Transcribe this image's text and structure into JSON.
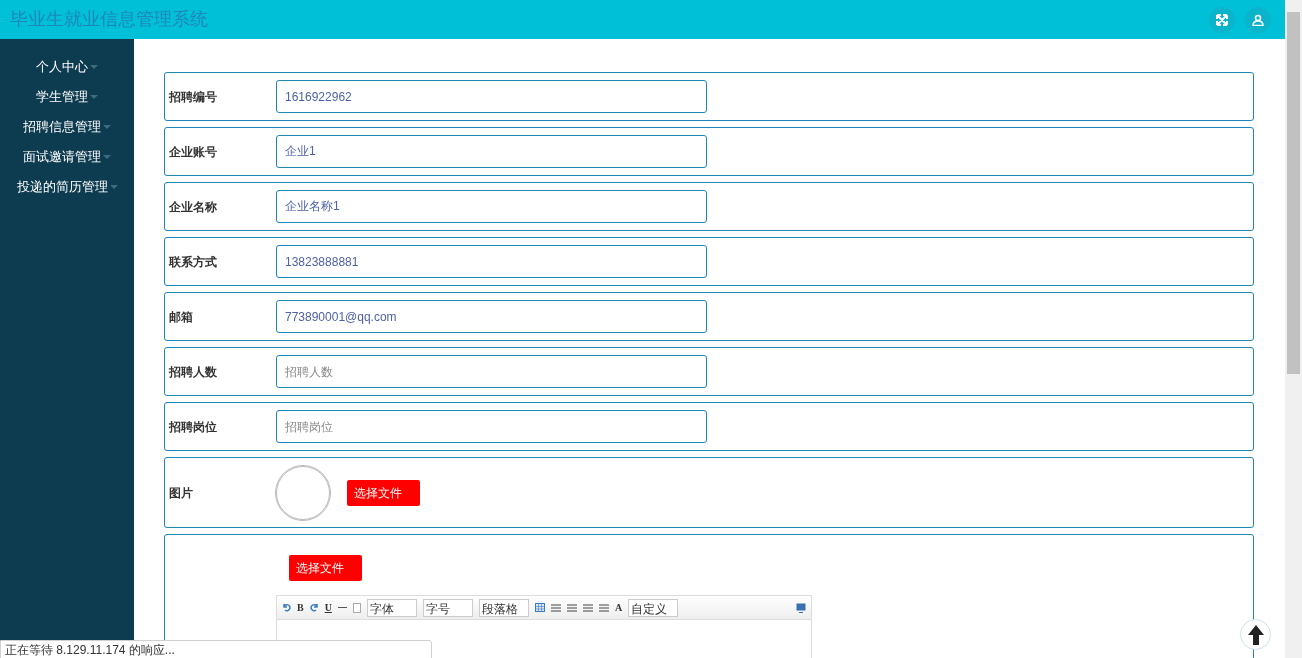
{
  "header": {
    "title": "毕业生就业信息管理系统"
  },
  "sidebar": {
    "items": [
      {
        "label": "个人中心"
      },
      {
        "label": "学生管理"
      },
      {
        "label": "招聘信息管理"
      },
      {
        "label": "面试邀请管理"
      },
      {
        "label": "投递的简历管理"
      }
    ]
  },
  "form": {
    "fields": [
      {
        "label": "招聘编号",
        "value": "1616922962"
      },
      {
        "label": "企业账号",
        "value": "企业1"
      },
      {
        "label": "企业名称",
        "value": "企业名称1"
      },
      {
        "label": "联系方式",
        "value": "13823888881"
      },
      {
        "label": "邮箱",
        "value": "773890001@qq.com"
      },
      {
        "label": "招聘人数",
        "placeholder": "招聘人数"
      },
      {
        "label": "招聘岗位",
        "placeholder": "招聘岗位"
      }
    ],
    "image_field": {
      "label": "图片",
      "button": "选择文件"
    },
    "editor_field": {
      "button": "选择文件",
      "toolbar": {
        "bold": "B",
        "underline": "U",
        "font_color": "A",
        "selects": [
          "字体",
          "字号",
          "段落格",
          "自定义"
        ]
      }
    }
  },
  "status_bar": {
    "text": "正在等待 8.129.11.174 的响应..."
  }
}
